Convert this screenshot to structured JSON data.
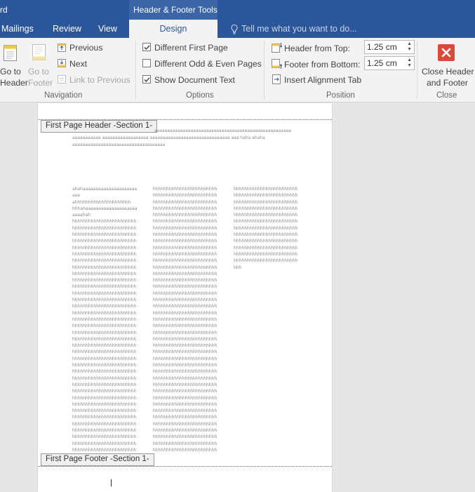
{
  "title_bar": {
    "app_fragment": "rd",
    "context_tab_group": "Header & Footer Tools"
  },
  "tabs": [
    {
      "label": "Mailings"
    },
    {
      "label": "Review"
    },
    {
      "label": "View"
    },
    {
      "label": "Design",
      "active": true
    }
  ],
  "tell_me": {
    "placeholder": "Tell me what you want to do..."
  },
  "navigation": {
    "go_to_header": [
      "Go to",
      "Header"
    ],
    "go_to_footer": [
      "Go to",
      "Footer"
    ],
    "previous": "Previous",
    "next": "Next",
    "link_to_previous": "Link to Previous",
    "group_label": "Navigation"
  },
  "options": {
    "different_first_page": {
      "label": "Different First Page",
      "checked": true
    },
    "different_odd_even": {
      "label": "Different Odd & Even Pages",
      "checked": false
    },
    "show_document_text": {
      "label": "Show Document Text",
      "checked": true
    },
    "group_label": "Options"
  },
  "position": {
    "header_from_top": {
      "label": "Header from Top:",
      "value": "1.25 cm"
    },
    "footer_from_bottom": {
      "label": "Footer from Bottom:",
      "value": "1.25 cm"
    },
    "insert_alignment_tab": "Insert Alignment Tab",
    "group_label": "Position"
  },
  "close": {
    "button": [
      "Close Header",
      "and Footer"
    ],
    "group_label": "Close"
  },
  "document": {
    "header_tag": "First Page Header -Section 1-",
    "footer_tag": "First Page Footer -Section 1-",
    "header_lines": [
      "aaaaaaaaaaaaaaaaaaaaaaaaaaaaaaaaaaaaaaaaaaaaaaaaaaaaa",
      "aaaaaaaaaaa aaaaaaaaaaaaaaaaaa aaaaaaaaaaaaaaaaaaaaaaaaaaaaaaa  aaa   haha ahaha",
      "aaaaaaaaaaaaaaaaaaaaaaaaaaaaaaaaaaaa"
    ],
    "column1": [
      "ahahaaaaaaaaaaaaaaaaaaaaa",
      "aaa",
      "ahhhhhhhhhhhhhhhhhhhhh",
      "hhhahaaaaaaaaaaaaaaaaaaaa",
      "aaaahah",
      "hhhhhhhhhhhhhhhhhhhhhhhh",
      "hhhhhhhhhhhhhhhhhhhhhhhh",
      "hhhhhhhhhhhhhhhhhhhhhhhh",
      "hhhhhhhhhhhhhhhhhhhhhhhh",
      "hhhhhhhhhhhhhhhhhhhhhhhh",
      "hhhhhhhhhhhhhhhhhhhhhhhh",
      "hhhhhhhhhhhhhhhhhhhhhhhh",
      "hhhhhhhhhhhhhhhhhhhhhhhh",
      "hhhhhhhhhhhhhhhhhhhhhhhh",
      "hhhhhhhhhhhhhhhhhhhhhhhh",
      "hhhhhhhhhhhhhhhhhhhhhhhh",
      "hhhhhhhhhhhhhhhhhhhhhhhh",
      "hhhhhhhhhhhhhhhhhhhhhhhh",
      "hhhhhhhhhhhhhhhhhhhhhhhh",
      "hhhhhhhhhhhhhhhhhhhhhhhh",
      "hhhhhhhhhhhhhhhhhhhhhhhh",
      "hhhhhhhhhhhhhhhhhhhhhhhh",
      "hhhhhhhhhhhhhhhhhhhhhhhh",
      "hhhhhhhhhhhhhhhhhhhhhhhh",
      "hhhhhhhhhhhhhhhhhhhhhhhh",
      "hhhhhhhhhhhhhhhhhhhhhhhh",
      "hhhhhhhhhhhhhhhhhhhhhhhh",
      "hhhhhhhhhhhhhhhhhhhhhhhh",
      "hhhhhhhhhhhhhhhhhhhhhhhh",
      "hhhhhhhhhhhhhhhhhhhhhhhh",
      "hhhhhhhhhhhhhhhhhhhhhhhh",
      "hhhhhhhhhhhhhhhhhhhhhhhh",
      "hhhhhhhhhhhhhhhhhhhhhhhh",
      "hhhhhhhhhhhhhhhhhhhhhhhh",
      "hhhhhhhhhhhhhhhhhhhhhhhh",
      "hhhhhhhhhhhhhhhhhhhhhhhh",
      "hhhhhhhhhhhhhhhhhhhhhhhh",
      "hhhhhhhhhhhhhhhhhhhhhhhh",
      "hhhhhhhhhhhhhhhhhhhhhhhh",
      "hhhhhhhhhhhhhhhhhhhhhhhh",
      "hhhhhhhhhhhhhhhhhhhhhhhh"
    ],
    "column2": [
      "hhhhhhhhhhhhhhhhhhhhhhhh",
      "hhhhhhhhhhhhhhhhhhhhhhhh",
      "hhhhhhhhhhhhhhhhhhhhhhhh",
      "hhhhhhhhhhhhhhhhhhhhhhhh",
      "hhhhhhhhhhhhhhhhhhhhhhhh",
      "hhhhhhhhhhhhhhhhhhhhhhhh",
      "hhhhhhhhhhhhhhhhhhhhhhhh",
      "hhhhhhhhhhhhhhhhhhhhhhhh",
      "hhhhhhhhhhhhhhhhhhhhhhhh",
      "hhhhhhhhhhhhhhhhhhhhhhhh",
      "hhhhhhhhhhhhhhhhhhhhhhhh",
      "hhhhhhhhhhhhhhhhhhhhhhhh",
      "hhhhhhhhhhhhhhhhhhhhhhhh",
      "hhhhhhhhhhhhhhhhhhhhhhhh",
      "hhhhhhhhhhhhhhhhhhhhhhhh",
      "hhhhhhhhhhhhhhhhhhhhhhhh",
      "hhhhhhhhhhhhhhhhhhhhhhhh",
      "hhhhhhhhhhhhhhhhhhhhhhhh",
      "hhhhhhhhhhhhhhhhhhhhhhhh",
      "hhhhhhhhhhhhhhhhhhhhhhhh",
      "hhhhhhhhhhhhhhhhhhhhhhhh",
      "hhhhhhhhhhhhhhhhhhhhhhhh",
      "hhhhhhhhhhhhhhhhhhhhhhhh",
      "hhhhhhhhhhhhhhhhhhhhhhhh",
      "hhhhhhhhhhhhhhhhhhhhhhhh",
      "hhhhhhhhhhhhhhhhhhhhhhhh",
      "hhhhhhhhhhhhhhhhhhhhhhhh",
      "hhhhhhhhhhhhhhhhhhhhhhhh",
      "hhhhhhhhhhhhhhhhhhhhhhhh",
      "hhhhhhhhhhhhhhhhhhhhhhhh",
      "hhhhhhhhhhhhhhhhhhhhhhhh",
      "hhhhhhhhhhhhhhhhhhhhhhhh",
      "hhhhhhhhhhhhhhhhhhhhhhhh",
      "hhhhhhhhhhhhhhhhhhhhhhhh",
      "hhhhhhhhhhhhhhhhhhhhhhhh",
      "hhhhhhhhhhhhhhhhhhhhhhhh",
      "hhhhhhhhhhhhhhhhhhhhhhhh",
      "hhhhhhhhhhhhhhhhhhhhhhhh",
      "hhhhhhhhhhhhhhhhhhhhhhhh",
      "hhhhhhhhhhhhhhhhhhhhhhhh",
      "hhhhhhhhhhhhhhhhhhhhhhhh"
    ],
    "column3": [
      "hhhhhhhhhhhhhhhhhhhhhhhh",
      "hhhhhhhhhhhhhhhhhhhhhhhh",
      "hhhhhhhhhhhhhhhhhhhhhhhh",
      "hhhhhhhhhhhhhhhhhhhhhhhh",
      "hhhhhhhhhhhhhhhhhhhhhhhh",
      "hhhhhhhhhhhhhhhhhhhhhhhh",
      "hhhhhhhhhhhhhhhhhhhhhhhh",
      "hhhhhhhhhhhhhhhhhhhhhhhh",
      "hhhhhhhhhhhhhhhhhhhhhhhh",
      "hhhhhhhhhhhhhhhhhhhhhhhh",
      "hhhhhhhhhhhhhhhhhhhhhhhh",
      "hhhhhhhhhhhhhhhhhhhhhhhh",
      "hhh"
    ]
  }
}
